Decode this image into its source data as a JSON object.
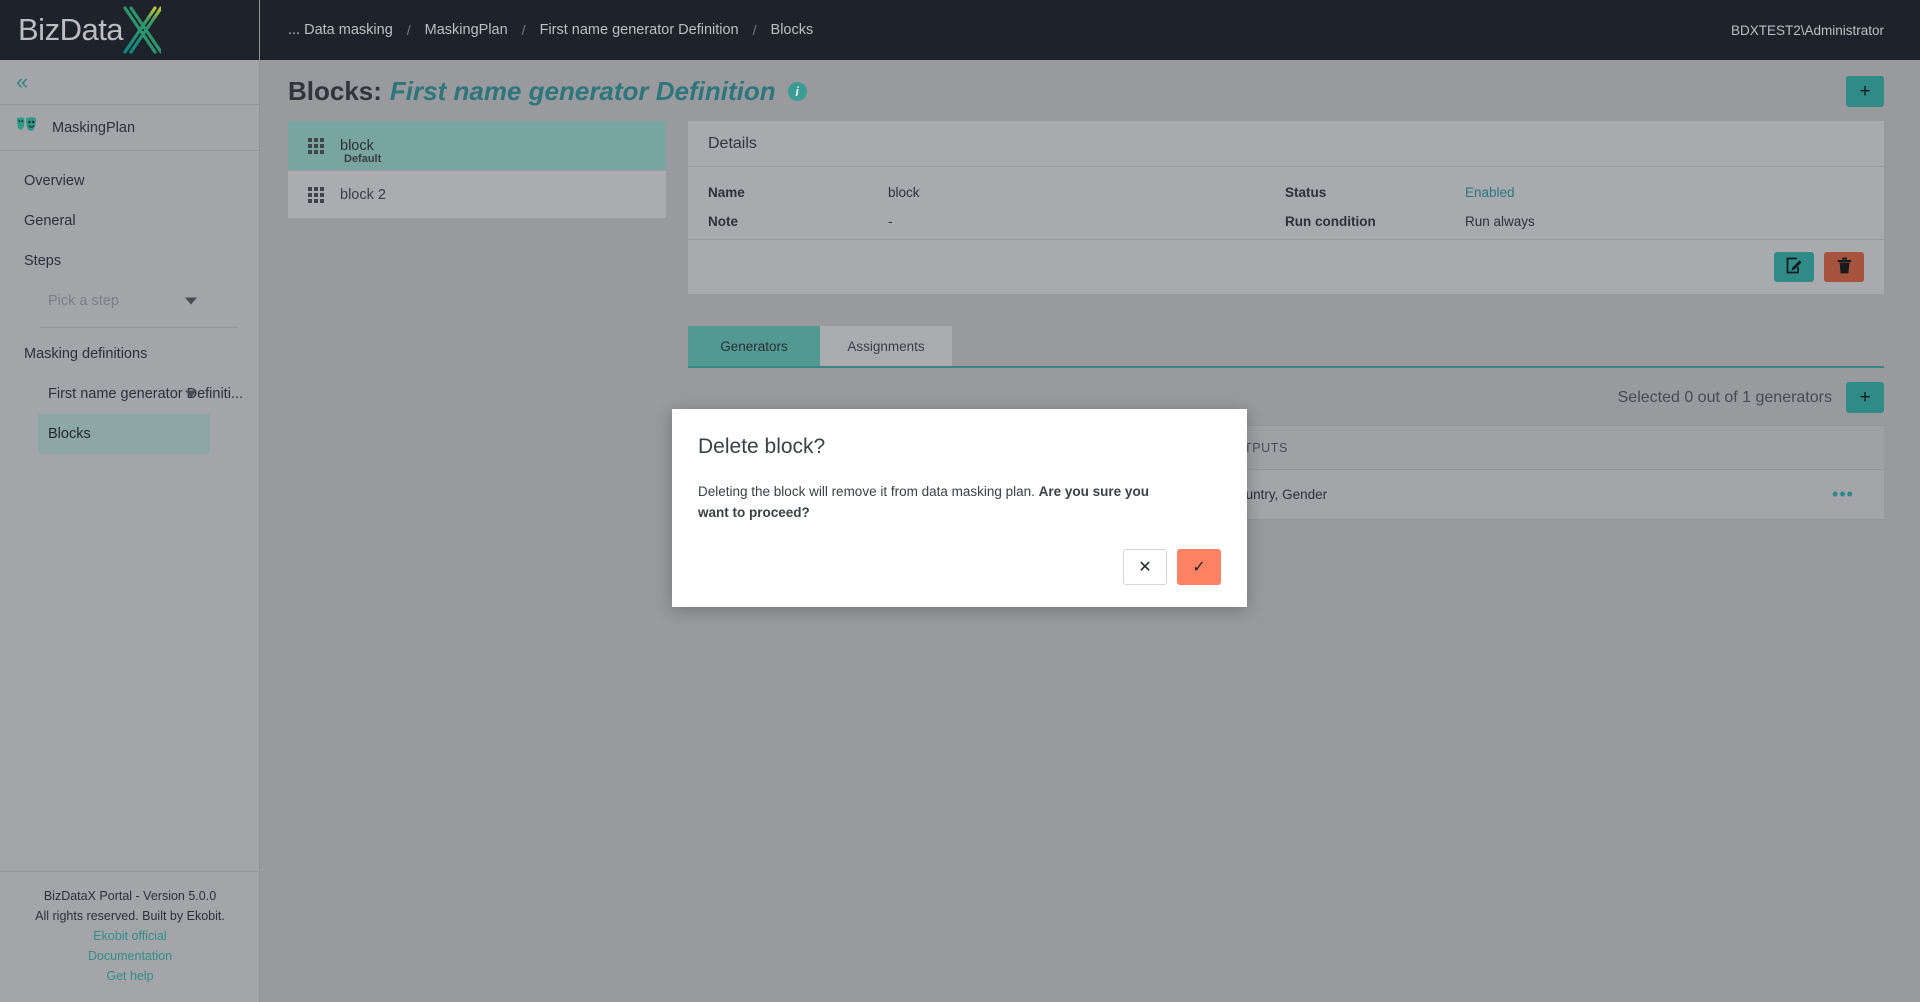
{
  "brand": {
    "name_text": "BizData",
    "logo_letter": "X"
  },
  "topbar": {
    "breadcrumbs": [
      {
        "label": "... Data masking"
      },
      {
        "label": "MaskingPlan"
      },
      {
        "label": "First name generator Definition"
      },
      {
        "label": "Blocks"
      }
    ],
    "separator": "/",
    "user": "BDXTEST2\\Administrator"
  },
  "sidebar": {
    "collapse_icon": "chevrons-left-icon",
    "plan": {
      "label": "MaskingPlan",
      "icon": "masks-icon"
    },
    "items": [
      {
        "label": "Overview",
        "selected": false
      },
      {
        "label": "General",
        "selected": false
      },
      {
        "label": "Steps",
        "selected": false
      },
      {
        "label": "Pick a step",
        "selected": false,
        "muted": true
      },
      {
        "label": "Masking definitions",
        "selected": false
      },
      {
        "label": "First name generator Definiti...",
        "selected": false
      },
      {
        "label": "Blocks",
        "selected": true
      }
    ],
    "footer": {
      "version": "BizDataX Portal - Version 5.0.0",
      "rights": "All rights reserved. Built by Ekobit.",
      "links": [
        {
          "label": "Ekobit official"
        },
        {
          "label": "Documentation"
        },
        {
          "label": "Get help"
        }
      ]
    }
  },
  "page": {
    "title_prefix": "Blocks:",
    "title_accent": "First name generator Definition",
    "info_glyph": "i",
    "add_label": "+"
  },
  "blocks": [
    {
      "name": "block",
      "sub": "Default",
      "active": true
    },
    {
      "name": "block 2",
      "sub": "",
      "active": false
    }
  ],
  "details": {
    "heading": "Details",
    "left": [
      {
        "key": "Name",
        "value": "block"
      },
      {
        "key": "Note",
        "value": "-"
      }
    ],
    "right": [
      {
        "key": "Status",
        "value": "Enabled",
        "link": true
      },
      {
        "key": "Run condition",
        "value": "Run always",
        "link": false
      }
    ],
    "edit_icon": "edit-pencil-icon",
    "delete_icon": "trash-icon"
  },
  "tabs": [
    {
      "label": "Generators",
      "active": true
    },
    {
      "label": "Assignments",
      "active": false
    }
  ],
  "generators": {
    "count_text": "Selected 0 out of 1 generators",
    "add_label": "+",
    "columns": [
      "OUTPUTS"
    ],
    "rows": [
      {
        "outputs": "Name, Country, Gender",
        "menu": "•••"
      }
    ]
  },
  "modal": {
    "title": "Delete block?",
    "body_normal": "Deleting the block will remove it from data masking plan. ",
    "body_bold": "Are you sure you want to proceed?",
    "cancel_glyph": "✕",
    "confirm_glyph": "✓"
  },
  "colors": {
    "teal": "#2f9490",
    "teal_light": "#7fb0a9",
    "dark": "#1e222a",
    "salmon": "#fd8163",
    "brick": "#b4573f",
    "page_bg": "#a2a4a8"
  }
}
